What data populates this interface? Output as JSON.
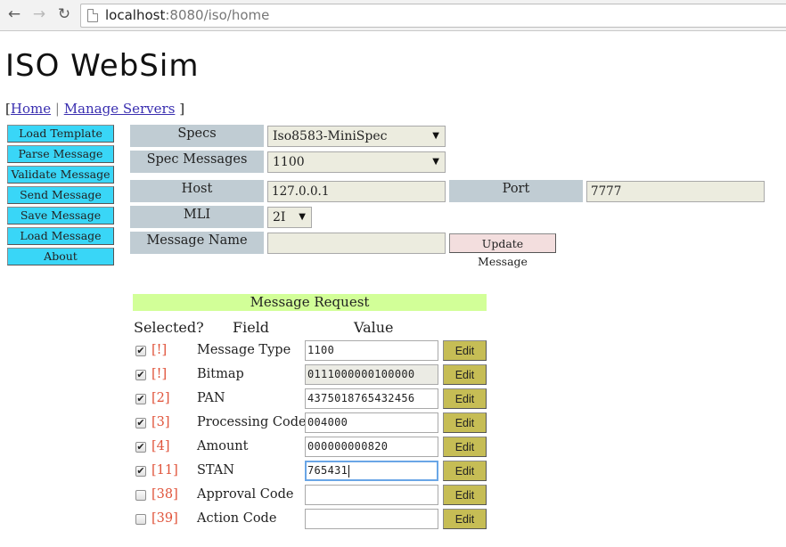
{
  "browser": {
    "url_host": "localhost",
    "url_path": ":8080/iso/home",
    "icons": [
      "back-arrow-icon",
      "forward-arrow-icon",
      "reload-icon",
      "page-icon"
    ]
  },
  "header": {
    "title": "ISO WebSim",
    "breadcrumb": {
      "open": "[",
      "home": "Home",
      "separator": "|",
      "manage": "Manage Servers",
      "close": "]"
    }
  },
  "sidebar": {
    "items": [
      {
        "label": "Load Template"
      },
      {
        "label": "Parse Message"
      },
      {
        "label": "Validate Message"
      },
      {
        "label": "Send Message"
      },
      {
        "label": "Save Message"
      },
      {
        "label": "Load Message"
      },
      {
        "label": "About"
      }
    ]
  },
  "form": {
    "specs_label": "Specs",
    "specs_value": "Iso8583-MiniSpec",
    "spec_messages_label": "Spec Messages",
    "spec_messages_value": "1100",
    "host_label": "Host",
    "host_value": "127.0.0.1",
    "port_label": "Port",
    "port_value": "7777",
    "mli_label": "MLI",
    "mli_value": "2I",
    "message_name_label": "Message Name",
    "message_name_value": "",
    "update_button": "Update Message"
  },
  "request": {
    "title": "Message Request",
    "col_selected": "Selected?",
    "col_field": "Field",
    "col_value": "Value",
    "edit_label": "Edit",
    "rows": [
      {
        "id": "[!]",
        "name": "Message Type",
        "value": "1100",
        "checked": true
      },
      {
        "id": "[!]",
        "name": "Bitmap",
        "value": "0111000000100000",
        "checked": true
      },
      {
        "id": "[2]",
        "name": "PAN",
        "value": "4375018765432456",
        "checked": true
      },
      {
        "id": "[3]",
        "name": "Processing Code",
        "value": "004000",
        "checked": true
      },
      {
        "id": "[4]",
        "name": "Amount",
        "value": "000000000820",
        "checked": true
      },
      {
        "id": "[11]",
        "name": "STAN",
        "value": "765431",
        "checked": true
      },
      {
        "id": "[38]",
        "name": "Approval Code",
        "value": "",
        "checked": false
      },
      {
        "id": "[39]",
        "name": "Action Code",
        "value": "",
        "checked": false
      }
    ]
  },
  "colors": {
    "sidebar_button": "#39d6f7",
    "label_background": "#c0ccd3",
    "request_header": "#d2ff98",
    "edit_button": "#c6bd55",
    "field_id": "#e0533a"
  }
}
